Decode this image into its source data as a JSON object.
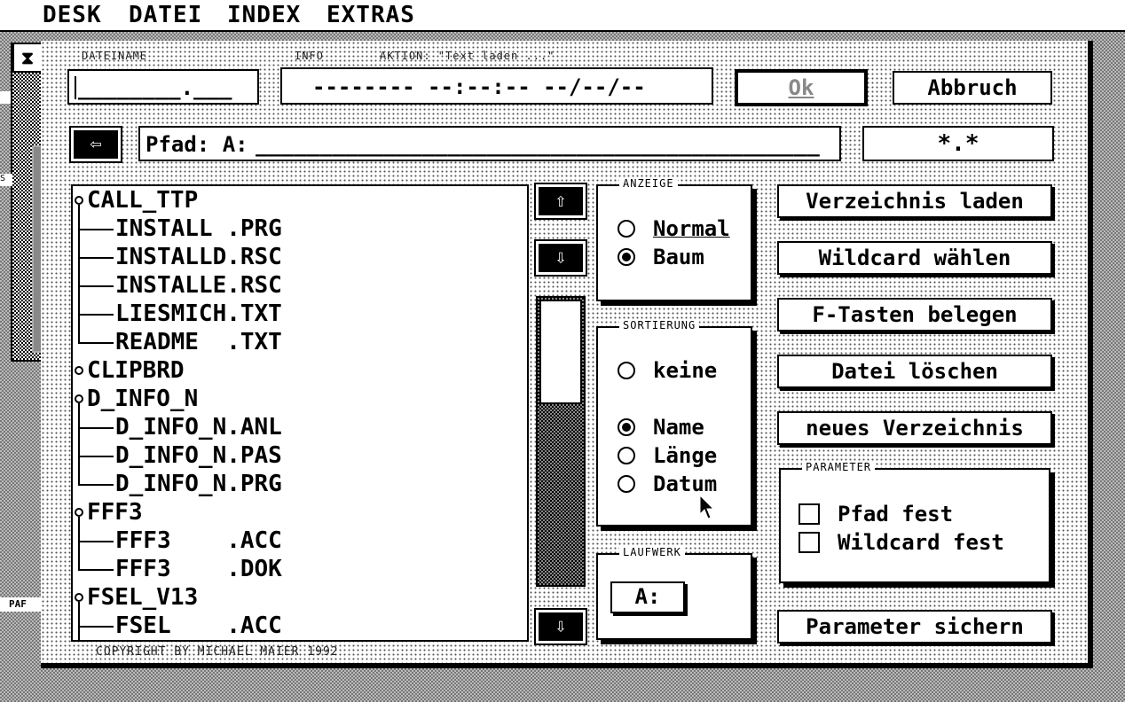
{
  "menubar": {
    "items": [
      "DESK",
      "DATEI",
      "INDEX",
      "EXTRAS"
    ]
  },
  "background": {
    "closer_icon": "close-box-icon",
    "side_label": "PAF",
    "side_label_s": "S"
  },
  "dialog": {
    "filename_label": "DATEINAME",
    "filename_value": "________.___",
    "info_label": "INFO",
    "action_label": "AKTION: \"Text laden ...\"",
    "info_value": "-------- --:--:-- --/--/--",
    "ok_button": "Ok",
    "cancel_button": "Abbruch",
    "parent_dir_icon": "arrow-left-icon",
    "path_label": "Pfad: A:",
    "path_value": "____________________________________________",
    "wildcard_value": "*.*",
    "copyright": "COPYRIGHT BY MICHAEL MAIER 1992"
  },
  "filelist": {
    "rows": [
      {
        "type": "dir",
        "name": "CALL_TTP"
      },
      {
        "type": "file",
        "name": "INSTALL .PRG"
      },
      {
        "type": "file",
        "name": "INSTALLD.RSC"
      },
      {
        "type": "file",
        "name": "INSTALLE.RSC"
      },
      {
        "type": "file",
        "name": "LIESMICH.TXT"
      },
      {
        "type": "file",
        "name": "README  .TXT",
        "last": true
      },
      {
        "type": "dir",
        "name": "CLIPBRD"
      },
      {
        "type": "dir",
        "name": "D_INFO_N"
      },
      {
        "type": "file",
        "name": "D_INFO_N.ANL"
      },
      {
        "type": "file",
        "name": "D_INFO_N.PAS"
      },
      {
        "type": "file",
        "name": "D_INFO_N.PRG",
        "last": true
      },
      {
        "type": "dir",
        "name": "FFF3"
      },
      {
        "type": "file",
        "name": "FFF3    .ACC"
      },
      {
        "type": "file",
        "name": "FFF3    .DOK",
        "last": true
      },
      {
        "type": "dir",
        "name": "FSEL_V13"
      },
      {
        "type": "file",
        "name": "FSEL    .ACC"
      }
    ],
    "scroll_up_icon": "arrow-up-icon",
    "scroll_down_icon": "arrow-down-icon",
    "scroll_position": 0,
    "visible_fraction": 0.37
  },
  "anzeige": {
    "title": "ANZEIGE",
    "options": [
      {
        "label": "Normal",
        "selected": false
      },
      {
        "label": "Baum",
        "selected": true
      }
    ]
  },
  "sortierung": {
    "title": "SORTIERUNG",
    "options": [
      {
        "label": "keine",
        "selected": false
      },
      {
        "label": "Name",
        "selected": true
      },
      {
        "label": "Länge",
        "selected": false
      },
      {
        "label": "Datum",
        "selected": false
      }
    ]
  },
  "laufwerk": {
    "title": "LAUFWERK",
    "drive": "A:"
  },
  "actions": {
    "load_dir": "Verzeichnis laden",
    "choose_wildcard": "Wildcard wählen",
    "fkeys": "F-Tasten belegen",
    "delete_file": "Datei löschen",
    "new_dir": "neues Verzeichnis",
    "save_params": "Parameter sichern"
  },
  "parameter": {
    "title": "PARAMETER",
    "options": [
      {
        "label": "Pfad fest",
        "checked": false
      },
      {
        "label": "Wildcard fest",
        "checked": false
      }
    ]
  }
}
